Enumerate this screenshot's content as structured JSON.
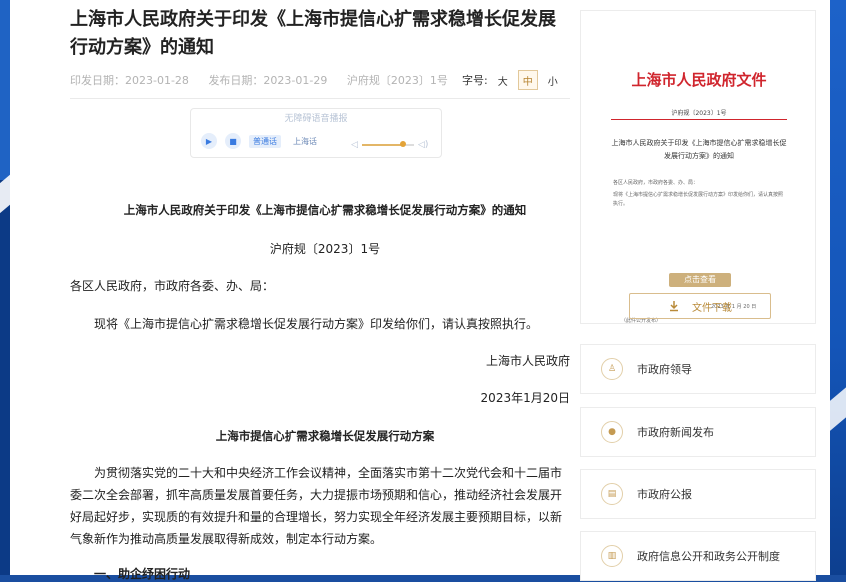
{
  "article": {
    "title": "上海市人民政府关于印发《上海市提信心扩需求稳增长促发展行动方案》的通知",
    "publish_label": "印发日期：2023-01-28",
    "release_label": "发布日期：2023-01-29",
    "doc_no": "沪府规〔2023〕1号"
  },
  "font_size": {
    "label": "字号:",
    "large": "大",
    "medium": "中",
    "small": "小",
    "selected": "中"
  },
  "player": {
    "hint": "无障碍语音播报",
    "mandarin": "普通话",
    "shanghainese": "上海话"
  },
  "doc": {
    "title": "上海市人民政府关于印发《上海市提信心扩需求稳增长促发展行动方案》的通知",
    "number": "沪府规〔2023〕1号",
    "addressee": "各区人民政府，市政府各委、办、局：",
    "intro": "现将《上海市提信心扩需求稳增长促发展行动方案》印发给你们，请认真按照执行。",
    "signer": "上海市人民政府",
    "date": "2023年1月20日",
    "plan_title": "上海市提信心扩需求稳增长促发展行动方案",
    "body": "为贯彻落实党的二十大和中央经济工作会议精神，全面落实市第十二次党代会和十二届市委二次全会部署，抓牢高质量发展首要任务，大力提振市场预期和信心，推动经济社会发展开好局起好步，实现质的有效提升和量的合理增长，努力实现全年经济发展主要预期目标，以新气象新作为推动高质量发展取得新成效，制定本行动方案。",
    "section1": "一、助企纾困行动"
  },
  "sidebar": {
    "preview": {
      "header": "上海市人民政府文件",
      "no": "沪府规〔2023〕1号",
      "title": "上海市人民政府关于印发《上海市提信心扩需求稳增长促发展行动方案》的通知",
      "line1": "各区人民政府，市政府各委、办、局：",
      "line2": "现将《上海市提信心扩需求稳增长促发展行动方案》印发给你们，请认真按照执行。",
      "date": "2023 年 1 月 20 日",
      "foot": "（此件公开发布）",
      "click": "点击查看"
    },
    "download": "文件下载",
    "links": [
      {
        "label": "市政府领导",
        "icon": "person-icon"
      },
      {
        "label": "市政府新闻发布",
        "icon": "microphone-icon"
      },
      {
        "label": "市政府公报",
        "icon": "newspaper-icon"
      },
      {
        "label": "政府信息公开和政务公开制度",
        "icon": "document-icon"
      }
    ]
  },
  "colors": {
    "brand_red": "#d0252d",
    "accent_gold": "#c49a52",
    "accent_blue": "#3a7be0"
  }
}
